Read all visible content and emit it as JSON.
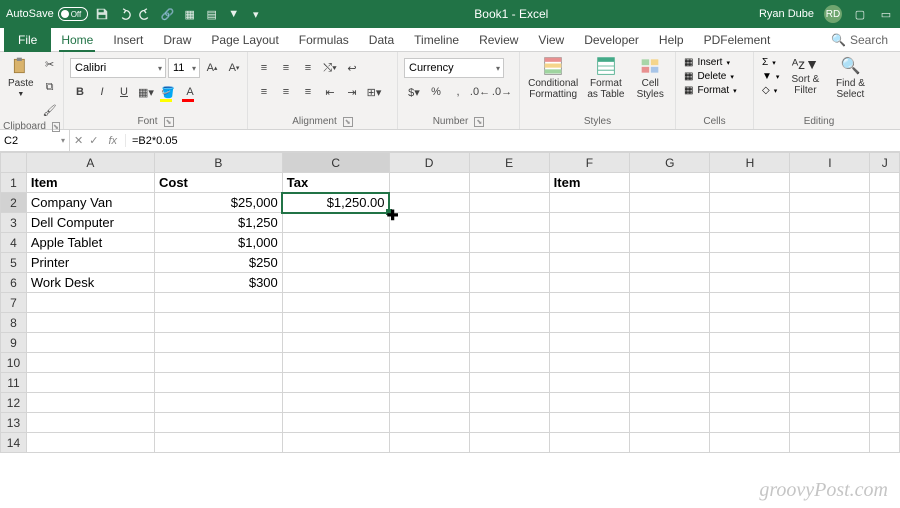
{
  "titlebar": {
    "autosave_label": "AutoSave",
    "autosave_state": "Off",
    "title": "Book1 - Excel",
    "user": "Ryan Dube",
    "avatar_initials": "RD"
  },
  "tabs": [
    "File",
    "Home",
    "Insert",
    "Draw",
    "Page Layout",
    "Formulas",
    "Data",
    "Timeline",
    "Review",
    "View",
    "Developer",
    "Help",
    "PDFelement"
  ],
  "active_tab": "Home",
  "search_placeholder": "Search",
  "ribbon": {
    "clipboard": {
      "label": "Clipboard",
      "paste": "Paste"
    },
    "font": {
      "label": "Font",
      "name": "Calibri",
      "size": "11"
    },
    "alignment": {
      "label": "Alignment"
    },
    "number": {
      "label": "Number",
      "format": "Currency"
    },
    "styles": {
      "label": "Styles",
      "cf": "Conditional Formatting",
      "fat": "Format as Table",
      "cs": "Cell Styles"
    },
    "cells": {
      "label": "Cells",
      "insert": "Insert",
      "delete": "Delete",
      "format": "Format"
    },
    "editing": {
      "label": "Editing",
      "sort": "Sort & Filter",
      "find": "Find & Select"
    }
  },
  "formula_bar": {
    "cell_ref": "C2",
    "formula": "=B2*0.05"
  },
  "columns": [
    "A",
    "B",
    "C",
    "D",
    "E",
    "F",
    "G",
    "H",
    "I",
    "J"
  ],
  "sheet": {
    "headers": {
      "A": "Item",
      "B": "Cost",
      "C": "Tax",
      "F": "Item"
    },
    "rows": [
      {
        "n": 2,
        "A": "Company Van",
        "B": "$25,000",
        "C": "$1,250.00"
      },
      {
        "n": 3,
        "A": "Dell Computer",
        "B": "$1,250"
      },
      {
        "n": 4,
        "A": "Apple Tablet",
        "B": "$1,000"
      },
      {
        "n": 5,
        "A": "Printer",
        "B": "$250"
      },
      {
        "n": 6,
        "A": "Work Desk",
        "B": "$300"
      }
    ],
    "selected_cell": "C2"
  },
  "watermark": "groovyPost.com"
}
